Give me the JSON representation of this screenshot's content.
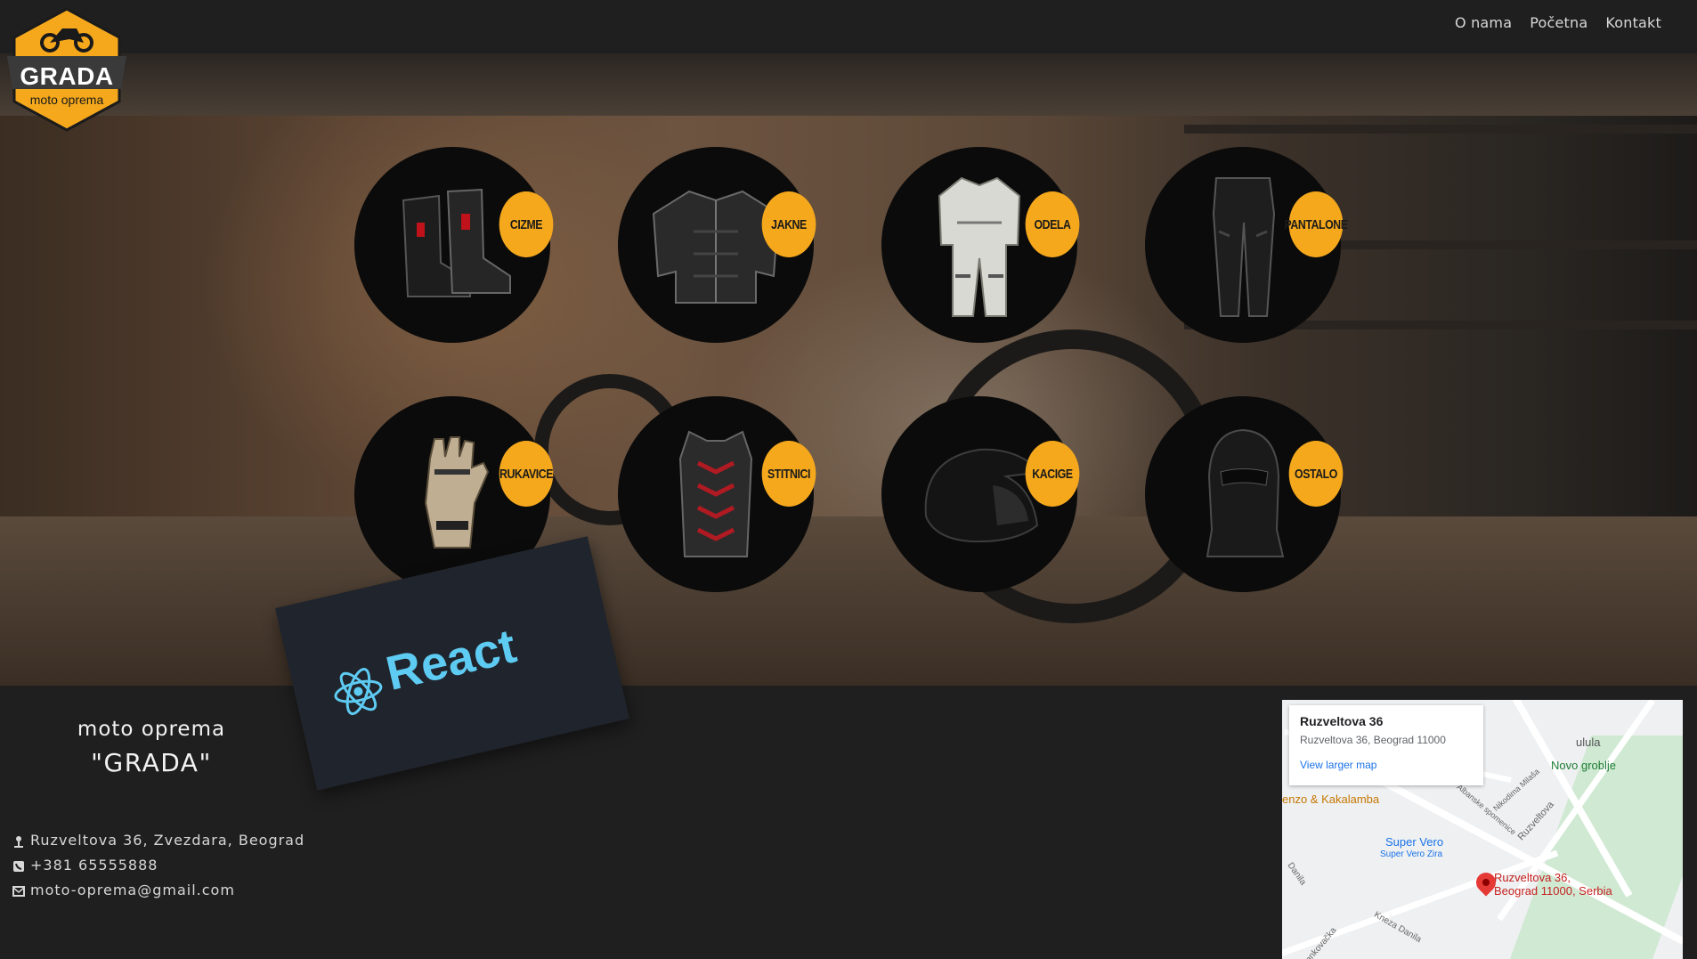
{
  "logo": {
    "title": "GRADA",
    "subtitle": "moto oprema"
  },
  "nav": {
    "items": [
      "O nama",
      "Početna",
      "Kontakt"
    ]
  },
  "categories": [
    {
      "label": "CIZME",
      "icon": "boots-icon"
    },
    {
      "label": "JAKNE",
      "icon": "jacket-icon"
    },
    {
      "label": "ODELA",
      "icon": "suit-icon"
    },
    {
      "label": "PANTALONE",
      "icon": "pants-icon"
    },
    {
      "label": "RUKAVICE",
      "icon": "gloves-icon"
    },
    {
      "label": "STITNICI",
      "icon": "body-armor-icon"
    },
    {
      "label": "KACIGE",
      "icon": "helmet-icon"
    },
    {
      "label": "OSTALO",
      "icon": "balaclava-icon"
    }
  ],
  "react_card": {
    "text": "React"
  },
  "footer": {
    "title_line1": "moto oprema",
    "title_line2": "\"GRADA\"",
    "address": "Ruzveltova 36, Zvezdara, Beograd",
    "phone": "+381 65555888",
    "email": "moto-oprema@gmail.com"
  },
  "map": {
    "card_title": "Ruzveltova 36",
    "card_address": "Ruzveltova 36, Beograd 11000",
    "card_link": "View larger map",
    "labels": {
      "ulula": "ulula",
      "novo_groblje": "Novo groblje",
      "kakalamba": "enzo & Kakalamba",
      "super_vero": "Super Vero",
      "super_vero_sub": "Super Vero Zira",
      "pin_line1": "Ruzveltova 36,",
      "pin_line2": "Beograd 11000, Serbia",
      "albanske": "Albanske spomenice",
      "nikodima": "Nikodima Milaša",
      "ruzveltova": "Ruzveltova",
      "danila": "Danila",
      "kneza_danila": "Kneza Danila",
      "jankovacka": "ankovačka"
    }
  },
  "colors": {
    "accent": "#f5a81c",
    "background": "#1f1f1f",
    "react": "#5ecbf2"
  }
}
